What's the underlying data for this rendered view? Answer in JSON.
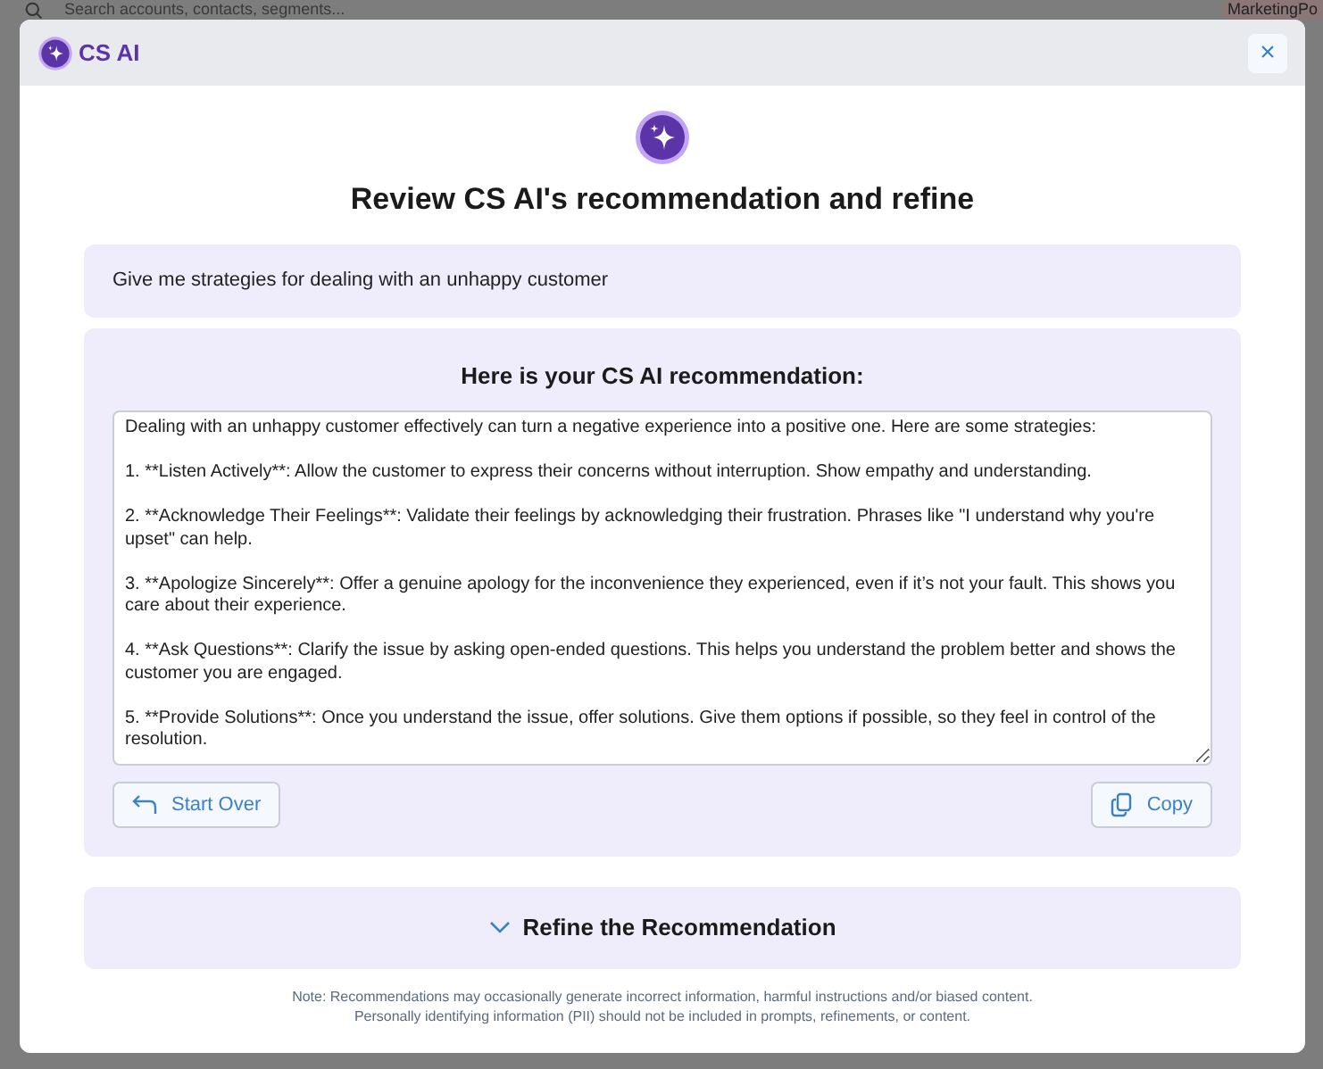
{
  "background": {
    "search": {
      "placeholder": "Search accounts, contacts, segments..."
    },
    "account_chip": "MarketingPo"
  },
  "dialog": {
    "brand": "CS AI",
    "close": "×",
    "title": "Review CS AI's recommendation and refine",
    "prompt": "Give me strategies for dealing with an unhappy customer",
    "recommendation": {
      "heading": "Here is your CS AI recommendation:",
      "text": "Dealing with an unhappy customer effectively can turn a negative experience into a positive one. Here are some strategies:\n\n1. **Listen Actively**: Allow the customer to express their concerns without interruption. Show empathy and understanding.\n\n2. **Acknowledge Their Feelings**: Validate their feelings by acknowledging their frustration. Phrases like \"I understand why you're upset\" can help.\n\n3. **Apologize Sincerely**: Offer a genuine apology for the inconvenience they experienced, even if it’s not your fault. This shows you care about their experience.\n\n4. **Ask Questions**: Clarify the issue by asking open-ended questions. This helps you understand the problem better and shows the customer you are engaged.\n\n5. **Provide Solutions**: Once you understand the issue, offer solutions. Give them options if possible, so they feel in control of the resolution.",
      "buttons": [
        {
          "label": "Start Over",
          "kind": "back"
        },
        {
          "label": "Copy",
          "kind": "copy"
        }
      ]
    },
    "refine": {
      "label": "Refine the Recommendation",
      "expanded": false
    },
    "notes": [
      "Note: Recommendations may occasionally generate incorrect information, harmful instructions and/or biased content.",
      "Personally identifying information (PII) should not be included in prompts, refinements, or content."
    ]
  }
}
